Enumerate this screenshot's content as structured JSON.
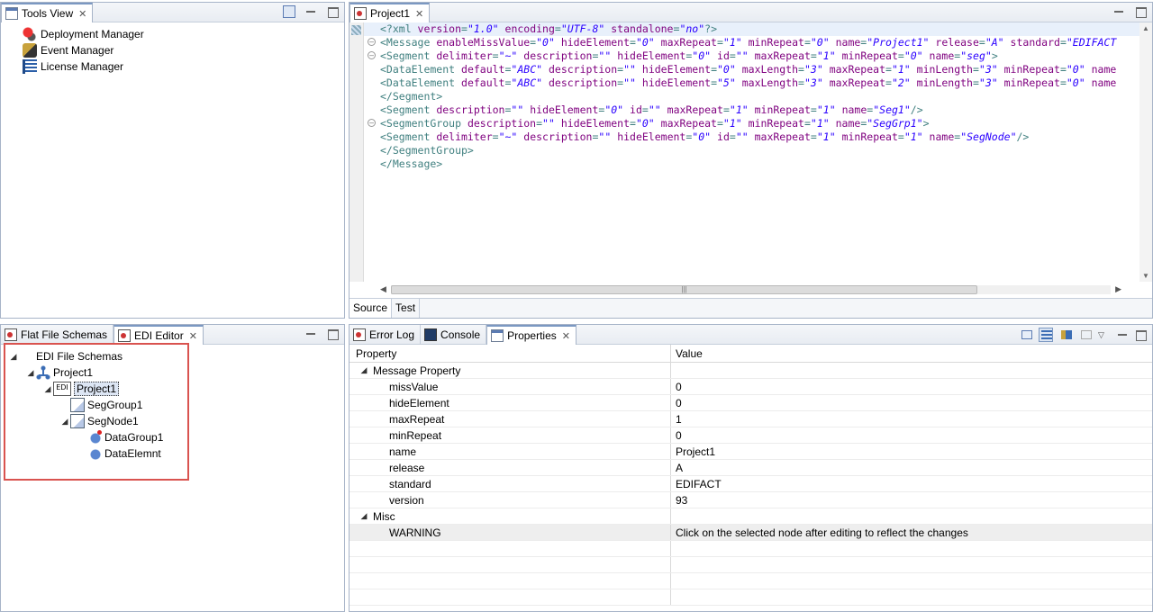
{
  "tools_view": {
    "tab_label": "Tools View",
    "items": [
      {
        "label": "Deployment Manager",
        "icon": "deployment-manager-icon"
      },
      {
        "label": "Event Manager",
        "icon": "event-manager-icon"
      },
      {
        "label": "License Manager",
        "icon": "license-manager-icon"
      }
    ]
  },
  "editor": {
    "tab_label": "Project1",
    "subtabs": [
      "Source",
      "Test"
    ],
    "active_subtab": "Source",
    "lines": [
      [
        {
          "t": "tag",
          "v": "<?xml "
        },
        {
          "t": "attr",
          "v": "version"
        },
        {
          "t": "tag",
          "v": "="
        },
        {
          "t": "val",
          "v": "\"1.0\""
        },
        {
          "t": "tag",
          "v": " "
        },
        {
          "t": "attr",
          "v": "encoding"
        },
        {
          "t": "tag",
          "v": "="
        },
        {
          "t": "val",
          "v": "\"UTF-8\""
        },
        {
          "t": "tag",
          "v": " "
        },
        {
          "t": "attr",
          "v": "standalone"
        },
        {
          "t": "tag",
          "v": "="
        },
        {
          "t": "val",
          "v": "\"no\""
        },
        {
          "t": "tag",
          "v": "?>"
        }
      ],
      [
        {
          "t": "tag",
          "v": "<Message "
        },
        {
          "t": "attr",
          "v": "enableMissValue"
        },
        {
          "t": "tag",
          "v": "="
        },
        {
          "t": "val",
          "v": "\"0\""
        },
        {
          "t": "tag",
          "v": " "
        },
        {
          "t": "attr",
          "v": "hideElement"
        },
        {
          "t": "tag",
          "v": "="
        },
        {
          "t": "val",
          "v": "\"0\""
        },
        {
          "t": "tag",
          "v": " "
        },
        {
          "t": "attr",
          "v": "maxRepeat"
        },
        {
          "t": "tag",
          "v": "="
        },
        {
          "t": "val",
          "v": "\"1\""
        },
        {
          "t": "tag",
          "v": " "
        },
        {
          "t": "attr",
          "v": "minRepeat"
        },
        {
          "t": "tag",
          "v": "="
        },
        {
          "t": "val",
          "v": "\"0\""
        },
        {
          "t": "tag",
          "v": " "
        },
        {
          "t": "attr",
          "v": "name"
        },
        {
          "t": "tag",
          "v": "="
        },
        {
          "t": "val",
          "v": "\"Project1\""
        },
        {
          "t": "tag",
          "v": " "
        },
        {
          "t": "attr",
          "v": "release"
        },
        {
          "t": "tag",
          "v": "="
        },
        {
          "t": "val",
          "v": "\"A\""
        },
        {
          "t": "tag",
          "v": " "
        },
        {
          "t": "attr",
          "v": "standard"
        },
        {
          "t": "tag",
          "v": "="
        },
        {
          "t": "val",
          "v": "\"EDIFACT"
        }
      ],
      [
        {
          "t": "tag",
          "v": "<Segment "
        },
        {
          "t": "attr",
          "v": "delimiter"
        },
        {
          "t": "tag",
          "v": "="
        },
        {
          "t": "val",
          "v": "\"~\""
        },
        {
          "t": "tag",
          "v": " "
        },
        {
          "t": "attr",
          "v": "description"
        },
        {
          "t": "tag",
          "v": "="
        },
        {
          "t": "val",
          "v": "\"\""
        },
        {
          "t": "tag",
          "v": " "
        },
        {
          "t": "attr",
          "v": "hideElement"
        },
        {
          "t": "tag",
          "v": "="
        },
        {
          "t": "val",
          "v": "\"0\""
        },
        {
          "t": "tag",
          "v": " "
        },
        {
          "t": "attr",
          "v": "id"
        },
        {
          "t": "tag",
          "v": "="
        },
        {
          "t": "val",
          "v": "\"\""
        },
        {
          "t": "tag",
          "v": " "
        },
        {
          "t": "attr",
          "v": "maxRepeat"
        },
        {
          "t": "tag",
          "v": "="
        },
        {
          "t": "val",
          "v": "\"1\""
        },
        {
          "t": "tag",
          "v": " "
        },
        {
          "t": "attr",
          "v": "minRepeat"
        },
        {
          "t": "tag",
          "v": "="
        },
        {
          "t": "val",
          "v": "\"0\""
        },
        {
          "t": "tag",
          "v": " "
        },
        {
          "t": "attr",
          "v": "name"
        },
        {
          "t": "tag",
          "v": "="
        },
        {
          "t": "val",
          "v": "\"seg\""
        },
        {
          "t": "tag",
          "v": ">"
        }
      ],
      [
        {
          "t": "tag",
          "v": "<DataElement "
        },
        {
          "t": "attr",
          "v": "default"
        },
        {
          "t": "tag",
          "v": "="
        },
        {
          "t": "val",
          "v": "\"ABC\""
        },
        {
          "t": "tag",
          "v": " "
        },
        {
          "t": "attr",
          "v": "description"
        },
        {
          "t": "tag",
          "v": "="
        },
        {
          "t": "val",
          "v": "\"\""
        },
        {
          "t": "tag",
          "v": " "
        },
        {
          "t": "attr",
          "v": "hideElement"
        },
        {
          "t": "tag",
          "v": "="
        },
        {
          "t": "val",
          "v": "\"0\""
        },
        {
          "t": "tag",
          "v": " "
        },
        {
          "t": "attr",
          "v": "maxLength"
        },
        {
          "t": "tag",
          "v": "="
        },
        {
          "t": "val",
          "v": "\"3\""
        },
        {
          "t": "tag",
          "v": " "
        },
        {
          "t": "attr",
          "v": "maxRepeat"
        },
        {
          "t": "tag",
          "v": "="
        },
        {
          "t": "val",
          "v": "\"1\""
        },
        {
          "t": "tag",
          "v": " "
        },
        {
          "t": "attr",
          "v": "minLength"
        },
        {
          "t": "tag",
          "v": "="
        },
        {
          "t": "val",
          "v": "\"3\""
        },
        {
          "t": "tag",
          "v": " "
        },
        {
          "t": "attr",
          "v": "minRepeat"
        },
        {
          "t": "tag",
          "v": "="
        },
        {
          "t": "val",
          "v": "\"0\""
        },
        {
          "t": "tag",
          "v": " "
        },
        {
          "t": "attr",
          "v": "name"
        }
      ],
      [
        {
          "t": "tag",
          "v": "<DataElement "
        },
        {
          "t": "attr",
          "v": "default"
        },
        {
          "t": "tag",
          "v": "="
        },
        {
          "t": "val",
          "v": "\"ABC\""
        },
        {
          "t": "tag",
          "v": " "
        },
        {
          "t": "attr",
          "v": "description"
        },
        {
          "t": "tag",
          "v": "="
        },
        {
          "t": "val",
          "v": "\"\""
        },
        {
          "t": "tag",
          "v": " "
        },
        {
          "t": "attr",
          "v": "hideElement"
        },
        {
          "t": "tag",
          "v": "="
        },
        {
          "t": "val",
          "v": "\"5\""
        },
        {
          "t": "tag",
          "v": " "
        },
        {
          "t": "attr",
          "v": "maxLength"
        },
        {
          "t": "tag",
          "v": "="
        },
        {
          "t": "val",
          "v": "\"3\""
        },
        {
          "t": "tag",
          "v": " "
        },
        {
          "t": "attr",
          "v": "maxRepeat"
        },
        {
          "t": "tag",
          "v": "="
        },
        {
          "t": "val",
          "v": "\"2\""
        },
        {
          "t": "tag",
          "v": " "
        },
        {
          "t": "attr",
          "v": "minLength"
        },
        {
          "t": "tag",
          "v": "="
        },
        {
          "t": "val",
          "v": "\"3\""
        },
        {
          "t": "tag",
          "v": " "
        },
        {
          "t": "attr",
          "v": "minRepeat"
        },
        {
          "t": "tag",
          "v": "="
        },
        {
          "t": "val",
          "v": "\"0\""
        },
        {
          "t": "tag",
          "v": " "
        },
        {
          "t": "attr",
          "v": "name"
        }
      ],
      [
        {
          "t": "tag",
          "v": "</Segment>"
        }
      ],
      [
        {
          "t": "tag",
          "v": "<Segment "
        },
        {
          "t": "attr",
          "v": "description"
        },
        {
          "t": "tag",
          "v": "="
        },
        {
          "t": "val",
          "v": "\"\""
        },
        {
          "t": "tag",
          "v": " "
        },
        {
          "t": "attr",
          "v": "hideElement"
        },
        {
          "t": "tag",
          "v": "="
        },
        {
          "t": "val",
          "v": "\"0\""
        },
        {
          "t": "tag",
          "v": " "
        },
        {
          "t": "attr",
          "v": "id"
        },
        {
          "t": "tag",
          "v": "="
        },
        {
          "t": "val",
          "v": "\"\""
        },
        {
          "t": "tag",
          "v": " "
        },
        {
          "t": "attr",
          "v": "maxRepeat"
        },
        {
          "t": "tag",
          "v": "="
        },
        {
          "t": "val",
          "v": "\"1\""
        },
        {
          "t": "tag",
          "v": " "
        },
        {
          "t": "attr",
          "v": "minRepeat"
        },
        {
          "t": "tag",
          "v": "="
        },
        {
          "t": "val",
          "v": "\"1\""
        },
        {
          "t": "tag",
          "v": " "
        },
        {
          "t": "attr",
          "v": "name"
        },
        {
          "t": "tag",
          "v": "="
        },
        {
          "t": "val",
          "v": "\"Seg1\""
        },
        {
          "t": "tag",
          "v": "/>"
        }
      ],
      [
        {
          "t": "tag",
          "v": "<SegmentGroup "
        },
        {
          "t": "attr",
          "v": "description"
        },
        {
          "t": "tag",
          "v": "="
        },
        {
          "t": "val",
          "v": "\"\""
        },
        {
          "t": "tag",
          "v": " "
        },
        {
          "t": "attr",
          "v": "hideElement"
        },
        {
          "t": "tag",
          "v": "="
        },
        {
          "t": "val",
          "v": "\"0\""
        },
        {
          "t": "tag",
          "v": " "
        },
        {
          "t": "attr",
          "v": "maxRepeat"
        },
        {
          "t": "tag",
          "v": "="
        },
        {
          "t": "val",
          "v": "\"1\""
        },
        {
          "t": "tag",
          "v": " "
        },
        {
          "t": "attr",
          "v": "minRepeat"
        },
        {
          "t": "tag",
          "v": "="
        },
        {
          "t": "val",
          "v": "\"1\""
        },
        {
          "t": "tag",
          "v": " "
        },
        {
          "t": "attr",
          "v": "name"
        },
        {
          "t": "tag",
          "v": "="
        },
        {
          "t": "val",
          "v": "\"SegGrp1\""
        },
        {
          "t": "tag",
          "v": ">"
        }
      ],
      [
        {
          "t": "tag",
          "v": "<Segment "
        },
        {
          "t": "attr",
          "v": "delimiter"
        },
        {
          "t": "tag",
          "v": "="
        },
        {
          "t": "val",
          "v": "\"~\""
        },
        {
          "t": "tag",
          "v": " "
        },
        {
          "t": "attr",
          "v": "description"
        },
        {
          "t": "tag",
          "v": "="
        },
        {
          "t": "val",
          "v": "\"\""
        },
        {
          "t": "tag",
          "v": " "
        },
        {
          "t": "attr",
          "v": "hideElement"
        },
        {
          "t": "tag",
          "v": "="
        },
        {
          "t": "val",
          "v": "\"0\""
        },
        {
          "t": "tag",
          "v": " "
        },
        {
          "t": "attr",
          "v": "id"
        },
        {
          "t": "tag",
          "v": "="
        },
        {
          "t": "val",
          "v": "\"\""
        },
        {
          "t": "tag",
          "v": " "
        },
        {
          "t": "attr",
          "v": "maxRepeat"
        },
        {
          "t": "tag",
          "v": "="
        },
        {
          "t": "val",
          "v": "\"1\""
        },
        {
          "t": "tag",
          "v": " "
        },
        {
          "t": "attr",
          "v": "minRepeat"
        },
        {
          "t": "tag",
          "v": "="
        },
        {
          "t": "val",
          "v": "\"1\""
        },
        {
          "t": "tag",
          "v": " "
        },
        {
          "t": "attr",
          "v": "name"
        },
        {
          "t": "tag",
          "v": "="
        },
        {
          "t": "val",
          "v": "\"SegNode\""
        },
        {
          "t": "tag",
          "v": "/>"
        }
      ],
      [
        {
          "t": "tag",
          "v": "</SegmentGroup>"
        }
      ],
      [
        {
          "t": "tag",
          "v": "</Message>"
        }
      ]
    ],
    "fold_lines": [
      1,
      2,
      7
    ]
  },
  "edi_panel": {
    "tabs": [
      "Flat File Schemas",
      "EDI Editor"
    ],
    "active_tab": "EDI Editor",
    "tree": [
      {
        "label": "EDI File Schemas",
        "depth": 0,
        "expanded": true,
        "icon": "",
        "selected": false
      },
      {
        "label": "Project1",
        "depth": 1,
        "expanded": true,
        "icon": "project-icon",
        "selected": false
      },
      {
        "label": "Project1",
        "depth": 2,
        "expanded": true,
        "icon": "edi-message-icon",
        "selected": true
      },
      {
        "label": "SegGroup1",
        "depth": 3,
        "expanded": null,
        "icon": "segment-group-icon",
        "selected": false
      },
      {
        "label": "SegNode1",
        "depth": 3,
        "expanded": true,
        "icon": "segment-node-icon",
        "selected": false
      },
      {
        "label": "DataGroup1",
        "depth": 4,
        "expanded": null,
        "icon": "data-group-icon",
        "selected": false
      },
      {
        "label": "DataElemnt",
        "depth": 4,
        "expanded": null,
        "icon": "data-element-icon",
        "selected": false
      }
    ],
    "edi_icon_text": "EDI"
  },
  "properties_panel": {
    "tabs": [
      "Error Log",
      "Console",
      "Properties"
    ],
    "active_tab": "Properties",
    "col_property": "Property",
    "col_value": "Value",
    "categories": [
      {
        "name": "Message Property",
        "rows": [
          {
            "property": "missValue",
            "value": "0"
          },
          {
            "property": "hideElement",
            "value": "0"
          },
          {
            "property": "maxRepeat",
            "value": "1"
          },
          {
            "property": "minRepeat",
            "value": "0"
          },
          {
            "property": "name",
            "value": "Project1"
          },
          {
            "property": "release",
            "value": "A"
          },
          {
            "property": "standard",
            "value": "EDIFACT"
          },
          {
            "property": "version",
            "value": "93"
          }
        ]
      },
      {
        "name": "Misc",
        "rows": [
          {
            "property": "WARNING",
            "value": "Click on the selected node after editing to reflect the changes"
          }
        ]
      }
    ]
  },
  "colors": {
    "highlight_box": "#d9534f",
    "tab_border": "#a7b4c8"
  }
}
